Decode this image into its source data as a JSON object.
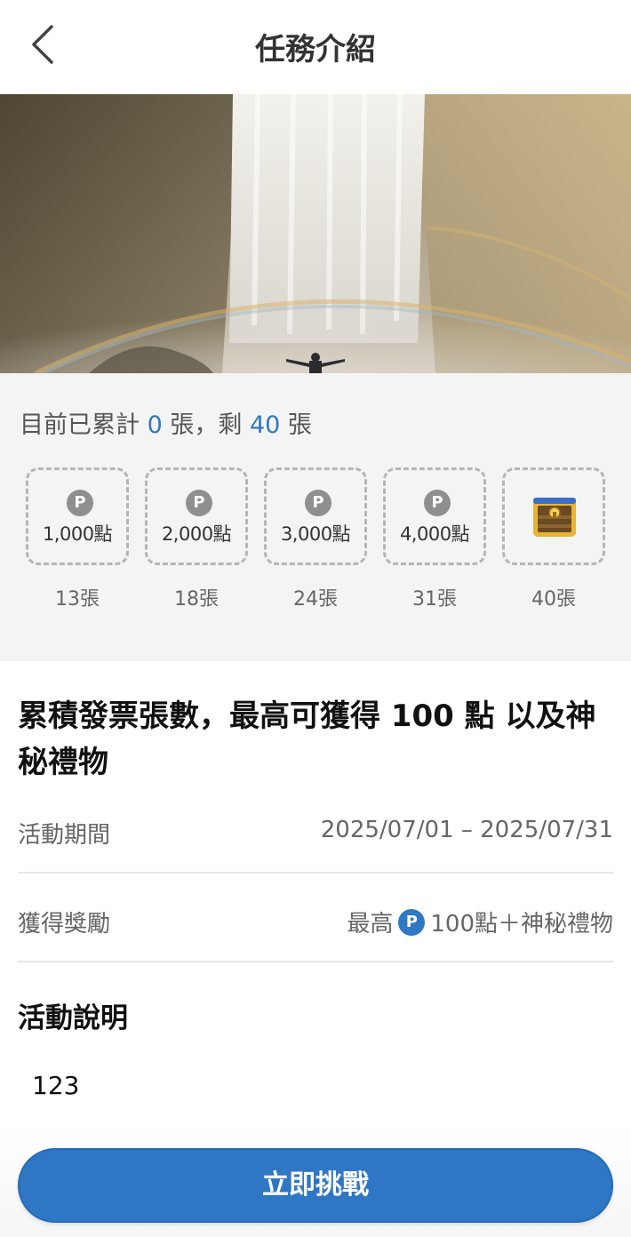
{
  "header": {
    "title": "任務介紹",
    "back_icon": "chevron-left-icon"
  },
  "progress": {
    "prefix": "目前已累計",
    "current": "0",
    "middle": "張，剩",
    "remaining": "40",
    "suffix": "張"
  },
  "milestones": [
    {
      "icon": "points-coin-icon",
      "points": "1,000點",
      "count": "13張"
    },
    {
      "icon": "points-coin-icon",
      "points": "2,000點",
      "count": "18張"
    },
    {
      "icon": "points-coin-icon",
      "points": "3,000點",
      "count": "24張"
    },
    {
      "icon": "points-coin-icon",
      "points": "4,000點",
      "count": "31張"
    },
    {
      "icon": "treasure-chest-icon",
      "points": "",
      "count": "40張"
    }
  ],
  "coin_letter": "P",
  "main_title": "累積發票張數，最高可獲得 100 點 以及神秘禮物",
  "info": {
    "period_label": "活動期間",
    "period_value": "2025/07/01 – 2025/07/31",
    "reward_label": "獲得獎勵",
    "reward_prefix": "最高",
    "reward_value": "100點＋神秘禮物"
  },
  "description": {
    "title": "活動說明",
    "body": "123"
  },
  "cta": {
    "label": "立即挑戰"
  },
  "colors": {
    "accent": "#2f78c4",
    "coin_gray": "#8f8f8f",
    "section_bg": "#f4f4f4"
  }
}
